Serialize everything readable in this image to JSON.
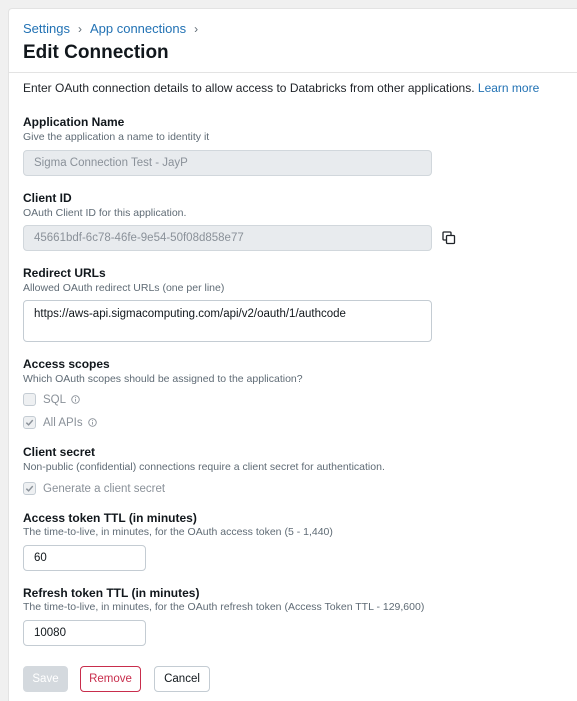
{
  "breadcrumb": {
    "items": [
      "Settings",
      "App connections"
    ],
    "separator": "›"
  },
  "page_title": "Edit Connection",
  "intro": {
    "text": "Enter OAuth connection details to allow access to Databricks from other applications.",
    "link": "Learn more"
  },
  "app_name": {
    "label": "Application Name",
    "hint": "Give the application a name to identity it",
    "value": "Sigma Connection Test - JayP"
  },
  "client_id": {
    "label": "Client ID",
    "hint": "OAuth Client ID for this application.",
    "value": "45661bdf-6c78-46fe-9e54-50f08d858e77",
    "copy_icon": "copy-icon"
  },
  "redirect_urls": {
    "label": "Redirect URLs",
    "hint": "Allowed OAuth redirect URLs (one per line)",
    "value": "https://aws-api.sigmacomputing.com/api/v2/oauth/1/authcode"
  },
  "access_scopes": {
    "label": "Access scopes",
    "hint": "Which OAuth scopes should be assigned to the application?",
    "options": [
      {
        "label": "SQL",
        "checked": false
      },
      {
        "label": "All APIs",
        "checked": true
      }
    ]
  },
  "client_secret": {
    "label": "Client secret",
    "hint": "Non-public (confidential) connections require a client secret for authentication.",
    "option": {
      "label": "Generate a client secret",
      "checked": true
    }
  },
  "access_ttl": {
    "label": "Access token TTL (in minutes)",
    "hint": "The time-to-live, in minutes, for the OAuth access token (5 - 1,440)",
    "value": "60"
  },
  "refresh_ttl": {
    "label": "Refresh token TTL (in minutes)",
    "hint": "The time-to-live, in minutes, for the OAuth refresh token (Access Token TTL - 129,600)",
    "value": "10080"
  },
  "buttons": {
    "save": "Save",
    "remove": "Remove",
    "cancel": "Cancel"
  },
  "colors": {
    "link": "#2272b4",
    "danger": "#c82d4c",
    "disabled_bg": "#e8ebee"
  }
}
